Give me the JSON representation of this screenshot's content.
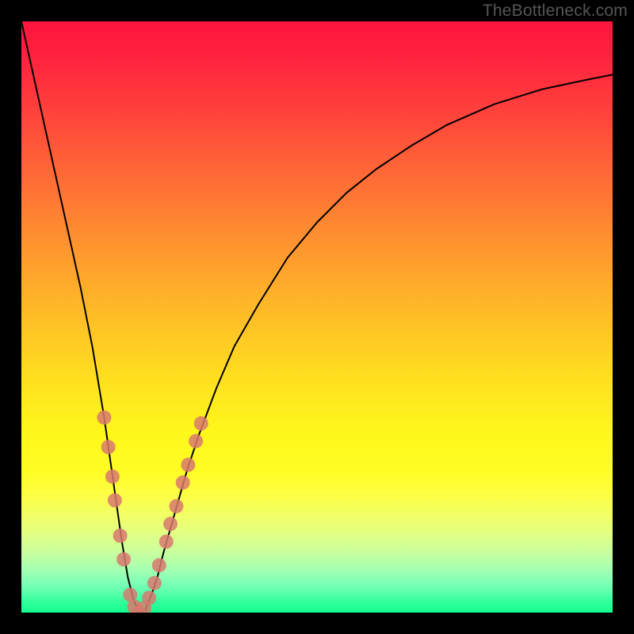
{
  "watermark": "TheBottleneck.com",
  "colors": {
    "frame": "#000000",
    "curve": "#000000",
    "marker_fill": "#d8796e",
    "marker_stroke": "#d8796e",
    "gradient_top": "#ff153e",
    "gradient_bottom": "#12ff8f"
  },
  "chart_data": {
    "type": "line",
    "title": "",
    "xlabel": "",
    "ylabel": "",
    "x_range": [
      0,
      100
    ],
    "y_range": [
      0,
      100
    ],
    "series": [
      {
        "name": "bottleneck-curve",
        "x": [
          0,
          2,
          4,
          6,
          8,
          10,
          12,
          14,
          15,
          16,
          17,
          18,
          19,
          20,
          21,
          22,
          23,
          24,
          26,
          28,
          30,
          33,
          36,
          40,
          45,
          50,
          55,
          60,
          66,
          72,
          80,
          88,
          95,
          100
        ],
        "y": [
          100,
          91,
          82,
          73,
          64,
          55,
          45,
          33,
          26,
          19,
          12,
          6,
          2,
          0,
          0.5,
          3,
          6,
          10,
          17,
          24,
          30,
          38,
          45,
          52,
          60,
          66,
          71,
          75,
          79,
          82.5,
          86,
          88.5,
          90,
          91
        ]
      }
    ],
    "markers": {
      "name": "highlighted-points",
      "points": [
        {
          "x": 14.0,
          "y": 33
        },
        {
          "x": 14.7,
          "y": 28
        },
        {
          "x": 15.4,
          "y": 23
        },
        {
          "x": 15.8,
          "y": 19
        },
        {
          "x": 16.7,
          "y": 13
        },
        {
          "x": 17.3,
          "y": 9
        },
        {
          "x": 18.4,
          "y": 3
        },
        {
          "x": 19.1,
          "y": 1
        },
        {
          "x": 19.9,
          "y": 0
        },
        {
          "x": 20.8,
          "y": 0.8
        },
        {
          "x": 21.6,
          "y": 2.5
        },
        {
          "x": 22.5,
          "y": 5
        },
        {
          "x": 23.3,
          "y": 8
        },
        {
          "x": 24.5,
          "y": 12
        },
        {
          "x": 25.2,
          "y": 15
        },
        {
          "x": 26.2,
          "y": 18
        },
        {
          "x": 27.3,
          "y": 22
        },
        {
          "x": 28.2,
          "y": 25
        },
        {
          "x": 29.5,
          "y": 29
        },
        {
          "x": 30.4,
          "y": 32
        }
      ]
    }
  }
}
